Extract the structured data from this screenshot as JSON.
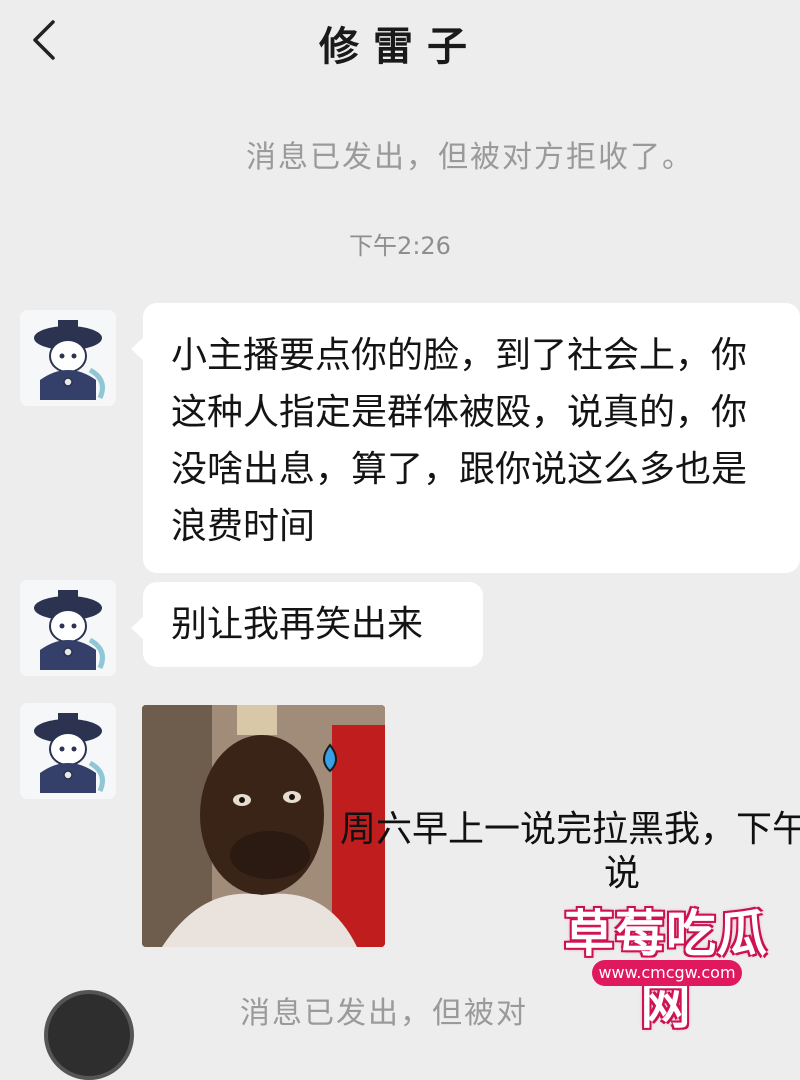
{
  "header": {
    "title": "修雷子",
    "back_icon": "chevron-left-icon"
  },
  "system_messages": {
    "rejected": "消息已发出，但被对方拒收了。",
    "rejected_partial": "消息已发出，但被对"
  },
  "timestamp": "下午2:26",
  "messages": [
    {
      "type": "text",
      "text": "小主播要点你的脸，到了社会上，你这种人指定是群体被殴，说真的，你没啥出息，算了，跟你说这么多也是浪费时间"
    },
    {
      "type": "text",
      "text": "别让我再笑出来"
    },
    {
      "type": "image",
      "overlay_line1": "周六早上一说完拉黑我，下午",
      "overlay_line2": "说"
    }
  ],
  "watermark": {
    "name": "草莓吃瓜网",
    "url": "www.cmcgw.com"
  },
  "colors": {
    "background": "#ededed",
    "bubble": "#ffffff",
    "system_text": "#9a9a9a",
    "watermark": "#e0185e"
  }
}
